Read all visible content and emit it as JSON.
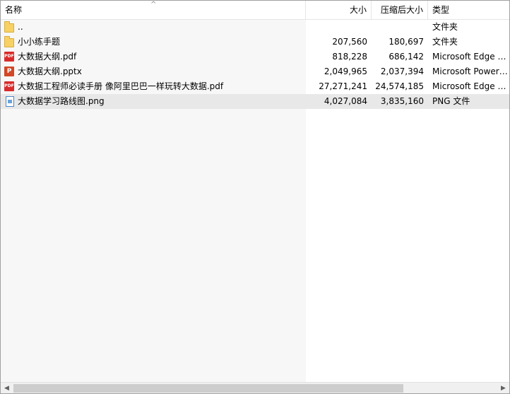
{
  "columns": {
    "name": "名称",
    "size": "大小",
    "compressed": "压缩后大小",
    "type": "类型",
    "sort_indicator": "^"
  },
  "files": [
    {
      "name": "..",
      "size": "",
      "compressed": "",
      "type": "文件夹",
      "icon": "folder-icon"
    },
    {
      "name": "小小练手题",
      "size": "207,560",
      "compressed": "180,697",
      "type": "文件夹",
      "icon": "folder-icon"
    },
    {
      "name": "大数据大纲.pdf",
      "size": "818,228",
      "compressed": "686,142",
      "type": "Microsoft Edge PDF 文档",
      "icon": "pdf-icon"
    },
    {
      "name": "大数据大纲.pptx",
      "size": "2,049,965",
      "compressed": "2,037,394",
      "type": "Microsoft PowerPoint 演示文稿",
      "icon": "pptx-icon"
    },
    {
      "name": "大数据工程师必读手册 像阿里巴巴一样玩转大数据.pdf",
      "size": "27,271,241",
      "compressed": "24,574,185",
      "type": "Microsoft Edge PDF 文档",
      "icon": "pdf-icon"
    },
    {
      "name": "大数据学习路线图.png",
      "size": "4,027,084",
      "compressed": "3,835,160",
      "type": "PNG 文件",
      "icon": "png-icon"
    }
  ],
  "icon_labels": {
    "pdf": "PDF",
    "pptx": "P"
  },
  "scrollbar": {
    "left": "◀",
    "right": "▶"
  }
}
